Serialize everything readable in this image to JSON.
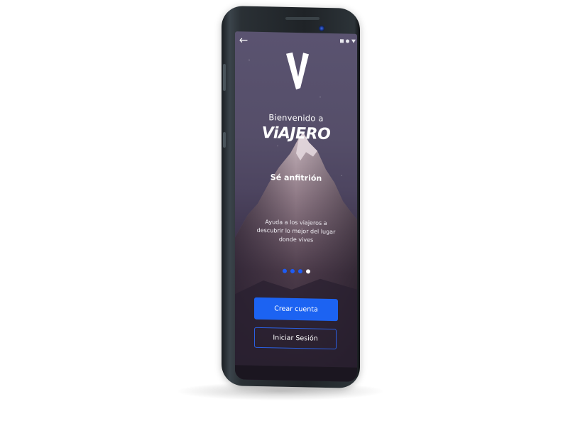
{
  "app": {
    "welcome_text": "Bienvenido a",
    "brand_name": "ViAJERO",
    "subtitle": "Sé anfitrión",
    "description_lines": [
      "Ayuda a los viajeros a",
      "descubrir lo mejor del lugar",
      "donde vives"
    ]
  },
  "navigation": {
    "back_icon": "arrow-left-icon",
    "back_glyph": "←"
  },
  "status_bar": {
    "icons": [
      "signal-icon",
      "wifi-icon",
      "battery-icon"
    ]
  },
  "pager": {
    "total": 4,
    "active_index": 3
  },
  "actions": {
    "create_account_label": "Crear cuenta",
    "sign_in_label": "Iniciar Sesión"
  },
  "colors": {
    "accent": "#1c63f2",
    "sky_top": "#5a5370",
    "sky_bottom": "#221a27",
    "text": "#ffffff"
  }
}
